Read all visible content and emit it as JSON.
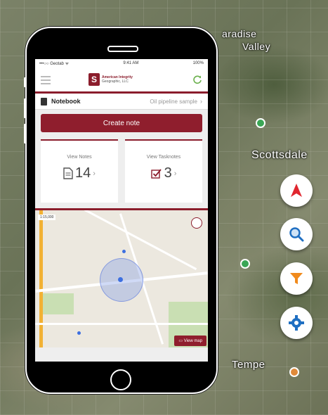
{
  "background_map": {
    "labels": [
      "aradise",
      "Valley",
      "Scottsdale",
      "Tempe"
    ]
  },
  "fab_buttons": [
    {
      "icon": "navigation-arrow-icon",
      "color": "#e0262f"
    },
    {
      "icon": "search-icon",
      "color": "#1f6fc2"
    },
    {
      "icon": "filter-icon",
      "color": "#f08a1c"
    },
    {
      "icon": "gear-icon",
      "color": "#1f6fc2"
    }
  ],
  "phone": {
    "status_bar": {
      "carrier": "•••○○ Geotab ᯤ",
      "time": "9:41 AM",
      "battery": "100%"
    },
    "brand": {
      "name": "American Integrity",
      "sub": "Geographic, LLC"
    },
    "notebook": {
      "label": "Notebook",
      "value": "Oil pipeline sample"
    },
    "create_note_label": "Create note",
    "cards": [
      {
        "label": "View Notes",
        "count": "14"
      },
      {
        "label": "View Tasknotes",
        "count": "3"
      }
    ],
    "map": {
      "scale": "1:15,000",
      "view_map_label": "View map"
    }
  },
  "colors": {
    "brand": "#8b1d2c",
    "accent": "#8f1e2d"
  }
}
